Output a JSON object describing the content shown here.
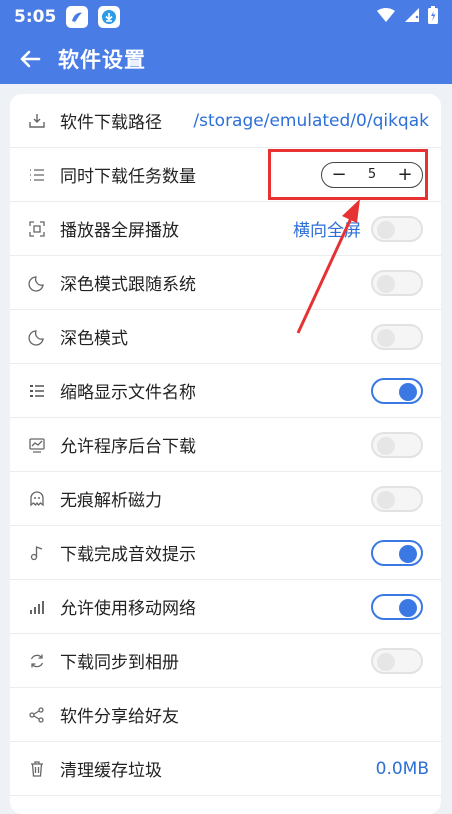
{
  "status_bar": {
    "time": "5:05"
  },
  "app_bar": {
    "title": "软件设置"
  },
  "settings": [
    {
      "label": "软件下载路径",
      "value": "/storage/emulated/0/qikqak"
    },
    {
      "label": "同时下载任务数量",
      "stepper": {
        "minus": "−",
        "value": "5",
        "plus": "+"
      }
    },
    {
      "label": "播放器全屏播放",
      "value": "横向全屏",
      "toggle": false
    },
    {
      "label": "深色模式跟随系统",
      "toggle": false
    },
    {
      "label": "深色模式",
      "toggle": false
    },
    {
      "label": "缩略显示文件名称",
      "toggle": true
    },
    {
      "label": "允许程序后台下载",
      "toggle": false
    },
    {
      "label": "无痕解析磁力",
      "toggle": false
    },
    {
      "label": "下载完成音效提示",
      "toggle": true
    },
    {
      "label": "允许使用移动网络",
      "toggle": true
    },
    {
      "label": "下载同步到相册",
      "toggle": false
    },
    {
      "label": "软件分享给好友"
    },
    {
      "label": "清理缓存垃圾",
      "value": "0.0MB"
    }
  ],
  "colors": {
    "primary": "#4a7ce6",
    "toggle_on": "#3a78e4",
    "annotation": "#e63232",
    "link": "#2d6fd8"
  }
}
